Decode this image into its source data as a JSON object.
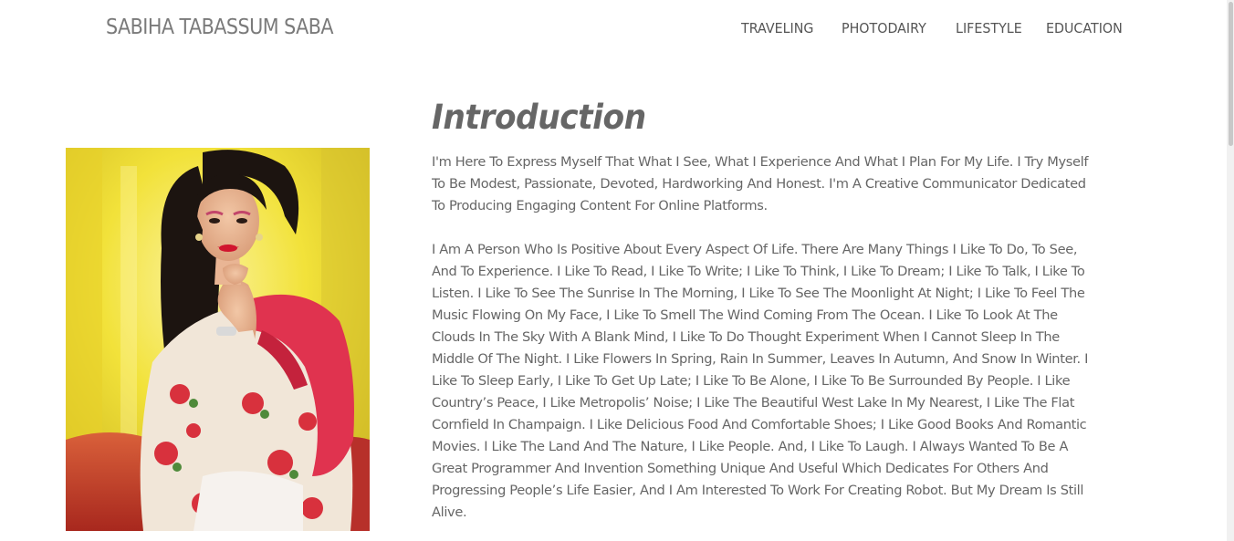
{
  "header": {
    "brand": "SABIHA TABASSUM SABA",
    "nav": [
      {
        "label": "TRAVELING"
      },
      {
        "label": "PHOTODAIRY"
      },
      {
        "label": "LIFESTYLE"
      },
      {
        "label": "EDUCATION"
      }
    ]
  },
  "main": {
    "title": "Introduction",
    "paragraphs": [
      "I'm Here To Express Myself That What I See, What I Experience And What I Plan For My Life. I Try Myself To Be Modest, Passionate, Devoted, Hardworking And Honest. I'm A Creative Communicator Dedicated To Producing Engaging Content For Online Platforms.",
      "I Am A Person Who Is Positive About Every Aspect Of Life. There Are Many Things I Like To Do, To See, And To Experience. I Like To Read, I Like To Write; I Like To Think, I Like To Dream; I Like To Talk, I Like To Listen. I Like To See The Sunrise In The Morning, I Like To See The Moonlight At Night; I Like To Feel The Music Flowing On My Face, I Like To Smell The Wind Coming From The Ocean. I Like To Look At The Clouds In The Sky With A Blank Mind, I Like To Do Thought Experiment When I Cannot Sleep In The Middle Of The Night. I Like Flowers In Spring, Rain In Summer, Leaves In Autumn, And Snow In Winter. I Like To Sleep Early, I Like To Get Up Late; I Like To Be Alone, I Like To Be Surrounded By People. I Like Country’s Peace, I Like Metropolis’ Noise; I Like The Beautiful West Lake In My Nearest, I Like The Flat Cornfield In Champaign. I Like Delicious Food And Comfortable Shoes; I Like Good Books And Romantic Movies. I Like The Land And The Nature, I Like People. And, I Like To Laugh. I Always Wanted To Be A Great Programmer And Invention Something Unique And Useful Which Dedicates For Others And Progressing People’s Life Easier, And I Am Interested To Work For Creating Robot. But My Dream Is Still Alive."
    ]
  },
  "colors": {
    "text": "#666666",
    "photo_background": "#f2e23a",
    "scarf": "#e0334f"
  }
}
